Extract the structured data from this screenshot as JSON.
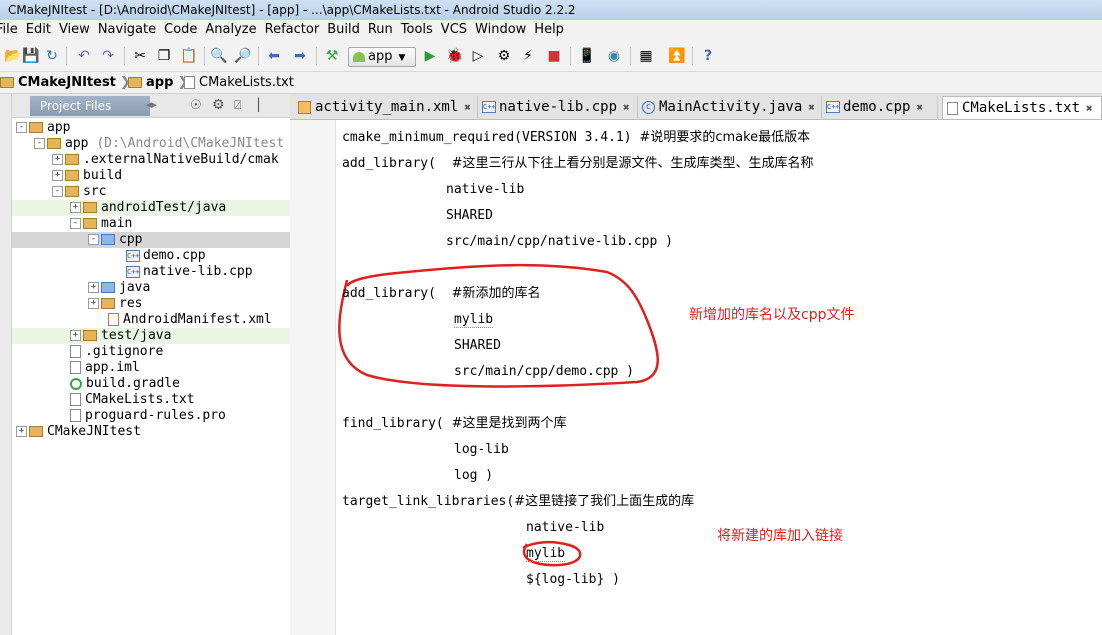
{
  "window": {
    "title": "CMakeJNItest - [D:\\Android\\CMakeJNItest] - [app] - ...\\app\\CMakeLists.txt - Android Studio 2.2.2"
  },
  "menu": [
    "File",
    "Edit",
    "View",
    "Navigate",
    "Code",
    "Analyze",
    "Refactor",
    "Build",
    "Run",
    "Tools",
    "VCS",
    "Window",
    "Help"
  ],
  "toolbar": {
    "run_config": "app",
    "help_glyph": "?"
  },
  "breadcrumb": [
    "CMakeJNItest",
    "app",
    "CMakeLists.txt"
  ],
  "project_panel": {
    "tab_label": "Project Files",
    "tree": [
      {
        "label": "app",
        "extra": ""
      },
      {
        "label": "app",
        "extra": "(D:\\Android\\CMakeJNItest"
      },
      {
        "label": ".externalNativeBuild/cmak",
        "extra": ""
      },
      {
        "label": "build",
        "extra": ""
      },
      {
        "label": "src",
        "extra": ""
      },
      {
        "label": "androidTest/java",
        "extra": ""
      },
      {
        "label": "main",
        "extra": ""
      },
      {
        "label": "cpp",
        "extra": ""
      },
      {
        "label": "demo.cpp",
        "extra": ""
      },
      {
        "label": "native-lib.cpp",
        "extra": ""
      },
      {
        "label": "java",
        "extra": ""
      },
      {
        "label": "res",
        "extra": ""
      },
      {
        "label": "AndroidManifest.xml",
        "extra": ""
      },
      {
        "label": "test/java",
        "extra": ""
      },
      {
        "label": ".gitignore",
        "extra": ""
      },
      {
        "label": "app.iml",
        "extra": ""
      },
      {
        "label": "build.gradle",
        "extra": ""
      },
      {
        "label": "CMakeLists.txt",
        "extra": ""
      },
      {
        "label": "proguard-rules.pro",
        "extra": ""
      },
      {
        "label": "CMakeJNItest",
        "extra": ""
      }
    ]
  },
  "tabs": [
    {
      "label": "activity_main.xml"
    },
    {
      "label": "native-lib.cpp"
    },
    {
      "label": "MainActivity.java"
    },
    {
      "label": "demo.cpp"
    },
    {
      "label": "CMakeLists.txt"
    }
  ],
  "editor": {
    "lines": [
      {
        "code": "cmake_minimum_required(VERSION 3.4.1) ",
        "comment": "#说明要求的cmake最低版本"
      },
      {
        "code": "add_library(  ",
        "comment": "#这里三行从下往上看分别是源文件、生成库类型、生成库名称"
      },
      {
        "code": "native-lib",
        "comment": ""
      },
      {
        "code": "SHARED",
        "comment": ""
      },
      {
        "code": "src/main/cpp/native-lib.cpp )",
        "comment": ""
      },
      {
        "code": "add_library(  ",
        "comment": "#新添加的库名"
      },
      {
        "code": "mylib",
        "comment": ""
      },
      {
        "code": "SHARED",
        "comment": ""
      },
      {
        "code": "src/main/cpp/demo.cpp )",
        "comment": ""
      },
      {
        "code": "find_library( ",
        "comment": "#这里是找到两个库"
      },
      {
        "code": "log-lib",
        "comment": ""
      },
      {
        "code": "log )",
        "comment": ""
      },
      {
        "code": "target_link_libraries(",
        "comment": "#这里链接了我们上面生成的库"
      },
      {
        "code": "native-lib",
        "comment": ""
      },
      {
        "code": "mylib",
        "comment": ""
      },
      {
        "code": "${log-lib} )",
        "comment": ""
      }
    ]
  },
  "annotations": {
    "note1": "新增加的库名以及cpp文件",
    "note2": "将新建的库加入链接"
  },
  "colors": {
    "annotation": "#e0201c",
    "project_tab": "#8a9cb2"
  }
}
